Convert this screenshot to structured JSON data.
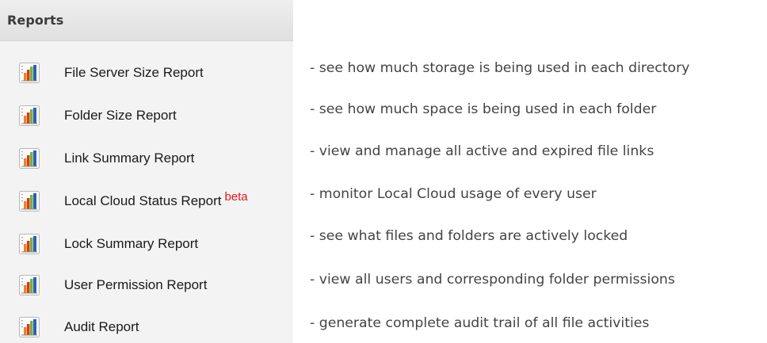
{
  "panel": {
    "title": "Reports"
  },
  "reports": [
    {
      "label": "File Server Size Report",
      "icon": "bar-chart-icon",
      "description": "- see how much storage is being used in each directory"
    },
    {
      "label": "Folder Size Report",
      "icon": "bar-chart-icon",
      "description": "- see how much space is being used in each folder"
    },
    {
      "label": "Link Summary Report",
      "icon": "bar-chart-icon",
      "description": "- view and manage all active and expired file links"
    },
    {
      "label": "Local Cloud Status Report",
      "badge": "beta",
      "icon": "bar-chart-icon",
      "description": "- monitor Local Cloud usage of every user"
    },
    {
      "label": "Lock Summary Report",
      "icon": "bar-chart-icon",
      "description": "- see what files and folders are actively locked"
    },
    {
      "label": "User Permission Report",
      "icon": "bar-chart-icon",
      "description": "- view all users and corresponding folder permissions"
    },
    {
      "label": "Audit Report",
      "icon": "bar-chart-icon",
      "description": "- generate complete audit trail of all file activities"
    }
  ],
  "colors": {
    "panel_bg": "#f3f3f3",
    "header_bg": "#e6e6e6",
    "beta": "#e8151b",
    "description_text": "#444444"
  }
}
